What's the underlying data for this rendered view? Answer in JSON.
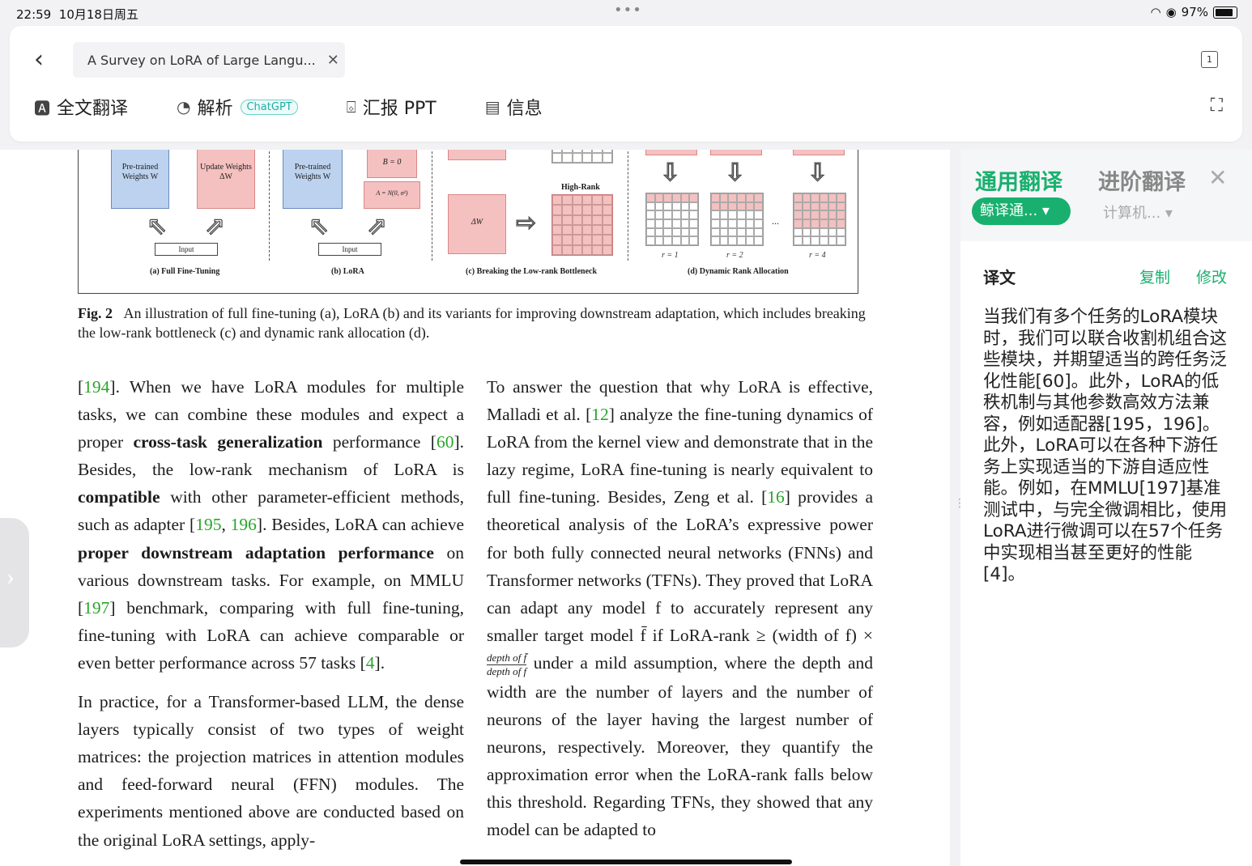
{
  "status": {
    "time": "22:59",
    "date": "10月18日周五",
    "battery": "97%"
  },
  "header": {
    "tab_title": "A Survey on LoRA of Large Langu...",
    "page_count": "1",
    "tools": [
      {
        "label": "全文翻译"
      },
      {
        "label": "解析",
        "badge": "ChatGPT"
      },
      {
        "label": "汇报 PPT"
      },
      {
        "label": "信息"
      }
    ]
  },
  "figure": {
    "blocks": {
      "pretrained": "Pre-trained Weights W",
      "update": "Update Weights ΔW",
      "pretrained2": "Pre-trained Weights W",
      "b_zero": "B = 0",
      "a_normal": "A = N(0, σ²)",
      "delta_w": "ΔW",
      "high_rank": "High-Rank",
      "input": "Input",
      "dots": "..."
    },
    "subcaptions": [
      "(a) Full Fine-Tuning",
      "(b) LoRA",
      "(c) Breaking the Low-rank Bottleneck",
      "(d) Dynamic Rank Allocation"
    ],
    "rank_labels": [
      "r = 1",
      "r = 2",
      "r = 4"
    ],
    "caption_label": "Fig. 2",
    "caption_text": "An illustration of full fine-tuning (a), LoRA (b) and its variants for improving downstream adaptation, which includes breaking the low-rank bottleneck (c) and dynamic rank allocation (d)."
  },
  "left_col": {
    "p1": {
      "r194": "194",
      "t1": "]. When we have LoRA modules for multiple tasks, we can combine these modules and expect a proper ",
      "b1": "cross-task generalization",
      "t2": " performance [",
      "r60": "60",
      "t3": "]. Besides, the low-rank mechanism of LoRA is ",
      "b2": "compatible",
      "t4": " with other parameter-efficient methods, such as adapter [",
      "r195": "195",
      "r196": "196",
      "t5": "]. Besides, LoRA can achieve ",
      "b3": "proper downstream adaptation performance",
      "t6": " on various downstream tasks. For example, on MMLU [",
      "r197": "197",
      "t7": "] benchmark, comparing with full fine-tuning, fine-tuning with LoRA can achieve comparable or even better performance across 57 tasks [",
      "r4": "4",
      "t8": "]."
    },
    "p2": "In practice, for a Transformer-based LLM, the dense layers typically consist of two types of weight matrices: the projection matrices in attention modules and feed-forward neural (FFN) modules. The experiments mentioned above are conducted based on the original LoRA settings, apply-"
  },
  "right_col": {
    "t1": "To answer the question that why LoRA is effective, Malladi et al. [",
    "r12": "12",
    "t2": "] analyze the fine-tuning dynamics of LoRA from the kernel view and demonstrate that in the lazy regime, LoRA fine-tuning is nearly equivalent to full fine-tuning. Besides, Zeng et al. [",
    "r16": "16",
    "t3": "] provides a theoretical analysis of the LoRA’s expressive power for both fully connected neural networks (FNNs) and Transformer networks (TFNs). They proved that LoRA can adapt any model f to accurately represent any smaller target model f̄ if LoRA-rank ≥ (width of f) × ",
    "frac_num": "depth of f̄",
    "frac_den": "depth of f",
    "t4": " under a mild assumption, where the depth and width are the number of layers and the number of neurons of the layer having the largest number of neurons, respectively. Moreover, they quantify the approximation error when the LoRA-rank falls below this threshold. Regarding TFNs, they showed that any model can be adapted to"
  },
  "panel": {
    "tab_general": "通用翻译",
    "tab_advanced": "进阶翻译",
    "engine": "鲸译通...",
    "engine_alt": "计算机...",
    "result_label": "译文",
    "copy": "复制",
    "edit": "修改",
    "translation": "当我们有多个任务的LoRA模块时，我们可以联合收割机组合这些模块，并期望适当的跨任务泛化性能[60]。此外，LoRA的低秩机制与其他参数高效方法兼容，例如适配器[195，196]。此外，LoRA可以在各种下游任务上实现适当的下游自适应性能。例如，在MMLU[197]基准测试中，与完全微调相比，使用LoRA进行微调可以在57个任务中实现相当甚至更好的性能[4]。"
  }
}
